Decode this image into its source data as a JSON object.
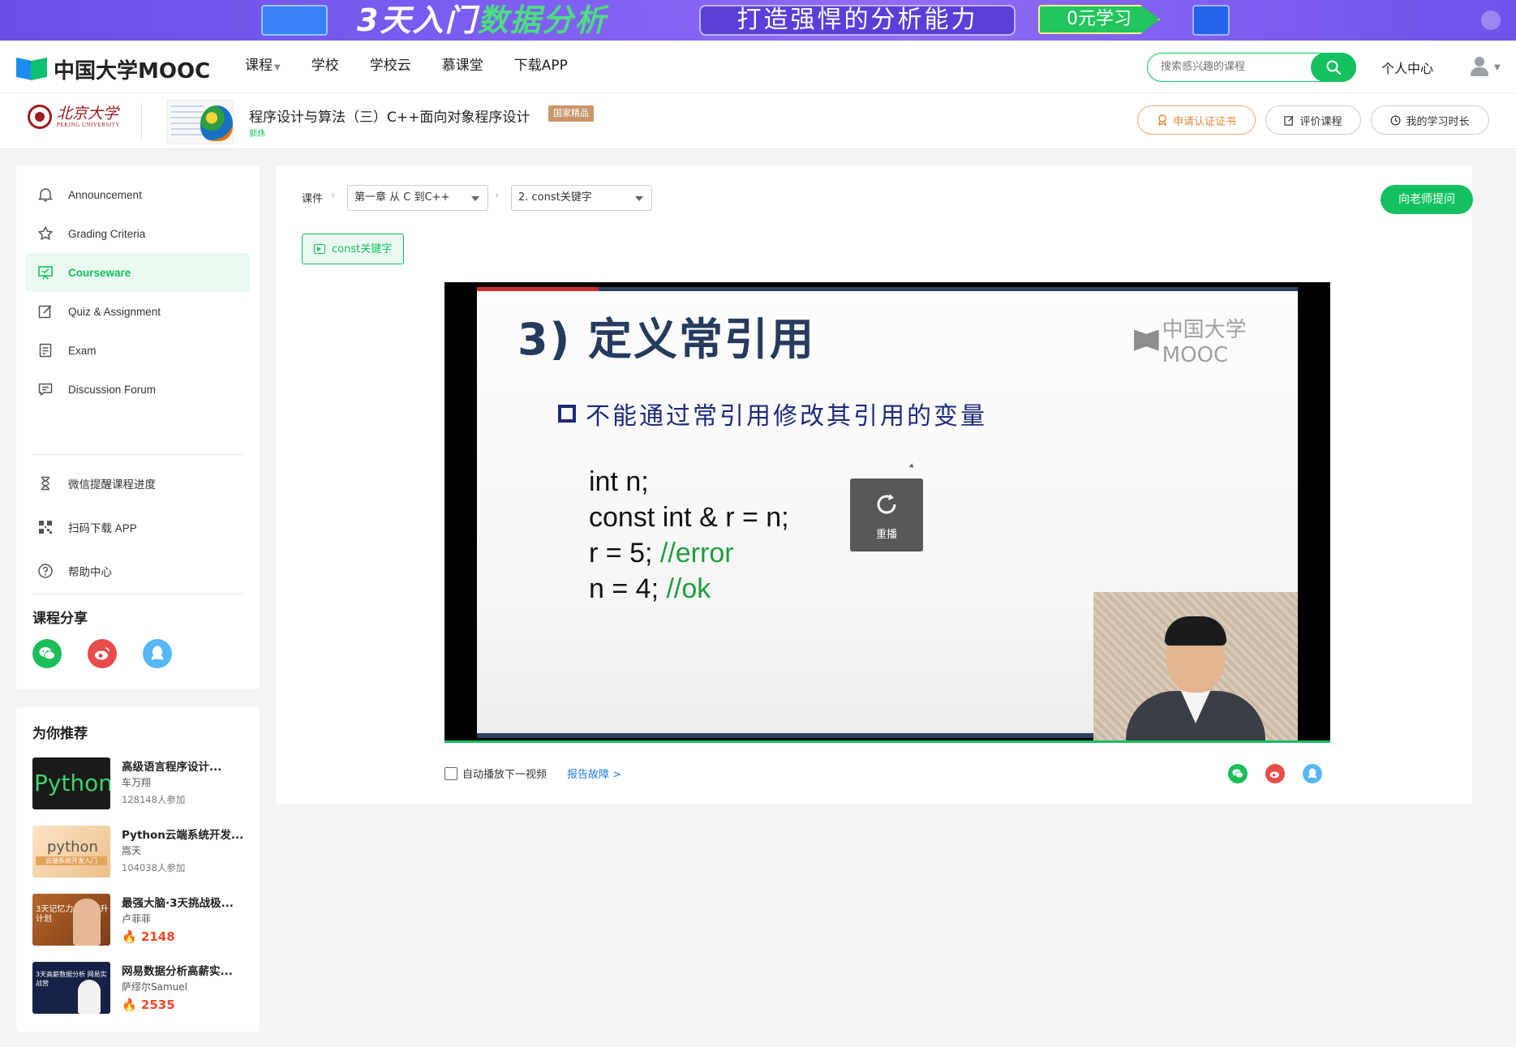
{
  "ad_banner": {
    "headline_a": "3天入门",
    "headline_b": "数据分析",
    "slogan": "打造强悍的分析能力",
    "cta": "0元学习"
  },
  "topnav": {
    "logo_text": "中国大学MOOC",
    "links": [
      "课程",
      "学校",
      "学校云",
      "慕课堂",
      "下载APP"
    ],
    "search_placeholder": "搜索感兴趣的课程",
    "personal_center": "个人中心"
  },
  "course": {
    "school_cn": "北京大学",
    "school_en": "PEKING UNIVERSITY",
    "title": "程序设计与算法（三）C++面向对象程序设计",
    "badge": "国家精品",
    "teacher": "郭炜",
    "buttons": {
      "certificate": "申请认证证书",
      "evaluate": "评价课程",
      "study_time": "我的学习时长"
    }
  },
  "sidebar": {
    "items": [
      {
        "label": "Announcement",
        "icon": "bell-icon"
      },
      {
        "label": "Grading Criteria",
        "icon": "star-icon"
      },
      {
        "label": "Courseware",
        "icon": "presentation-icon",
        "active": true
      },
      {
        "label": "Quiz & Assignment",
        "icon": "edit-icon"
      },
      {
        "label": "Exam",
        "icon": "exam-icon"
      },
      {
        "label": "Discussion Forum",
        "icon": "forum-icon"
      }
    ],
    "extra": [
      {
        "label": "微信提醒课程进度",
        "icon": "hourglass-icon"
      },
      {
        "label": "扫码下载 APP",
        "icon": "qrcode-icon"
      },
      {
        "label": "帮助中心",
        "icon": "help-icon"
      }
    ],
    "share_title": "课程分享"
  },
  "recommend": {
    "title": "为你推荐",
    "items": [
      {
        "title": "高级语言程序设计...",
        "author": "车万翔",
        "count": "128148人参加",
        "cover_text": "Python"
      },
      {
        "title": "Python云端系统开发...",
        "author": "嵩天",
        "count": "104038人参加",
        "cover_text": "python",
        "cover_sub": "云端系统开发入门"
      },
      {
        "title": "最强大脑·3天挑战极...",
        "author": "卢菲菲",
        "hot": "2148",
        "cover_text": "3天记忆力 全面提升计划"
      },
      {
        "title": "网易数据分析高薪实...",
        "author": "萨缪尔Samuel",
        "hot": "2535",
        "cover_text": "3天高薪数据分析 网易实战营"
      }
    ]
  },
  "main": {
    "crumb_label": "课件",
    "chapter": "第一章 从 C 到C++",
    "lesson": "2. const关键字",
    "ask_button": "向老师提问",
    "unit_tab": "const关键字",
    "slide": {
      "heading": "3) 定义常引用",
      "watermark": "中国大学MOOC",
      "bullet": "不能通过常引用修改其引用的变量",
      "code": [
        {
          "text": "int n;",
          "comment": ""
        },
        {
          "text": "const int & r = n;",
          "comment": ""
        },
        {
          "text": "r = 5; ",
          "comment": "//error"
        },
        {
          "text": "n = 4; ",
          "comment": "//ok"
        }
      ]
    },
    "replay_label": "重播",
    "autoplay_label": "自动播放下一视频",
    "report_label": "报告故障 >"
  },
  "colors": {
    "brand_green": "#13c15f",
    "link_blue": "#1c7de0",
    "cert_orange": "#e08a3a"
  }
}
